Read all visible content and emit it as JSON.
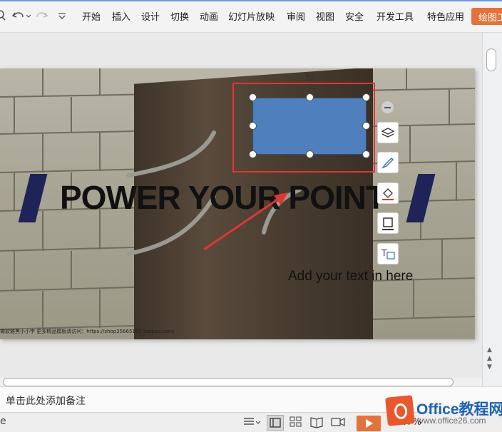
{
  "ribbon": {
    "tabs": [
      "开始",
      "插入",
      "设计",
      "切换",
      "动画",
      "幻灯片放映",
      "审阅",
      "视图",
      "安全",
      "开发工具",
      "特色应用"
    ],
    "active_tool_tab": "绘图工",
    "accent_color": "#e4723c"
  },
  "slide": {
    "title": "POWER YOUR POINT",
    "subtitle": "Add your text in here",
    "footer": "微软雅黑小小字 更多精品模板请访问：https://shop35665182.taobao.com/",
    "shape_fill": "#4f7fbd",
    "parallelogram_color": "#1e2457"
  },
  "float_toolbar": {
    "icons": [
      "collapse-icon",
      "layers-icon",
      "pen-icon",
      "fill-icon",
      "border-icon",
      "text-wrap-icon"
    ]
  },
  "notes": {
    "placeholder": "单击此处添加备注"
  },
  "statusbar": {
    "zoom_fragment": "47%"
  },
  "watermark": {
    "title": "Office教程网",
    "url": "www.office26.com",
    "badge_color": "#e8572d"
  }
}
